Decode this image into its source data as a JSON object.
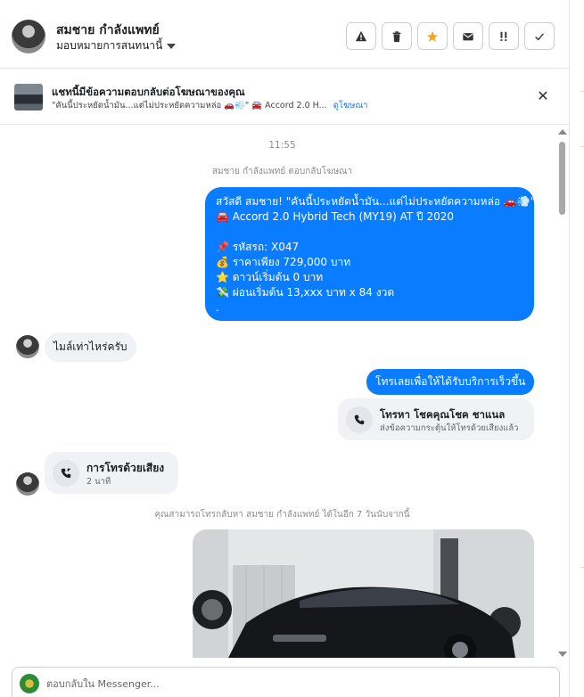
{
  "header": {
    "contact_name": "สมชาย กำลังแพทย์",
    "assign_label": "มอบหมายการสนทนานี้",
    "actions": [
      {
        "name": "report-button",
        "icon": "warning-icon",
        "glyph": "⚠"
      },
      {
        "name": "delete-button",
        "icon": "trash-icon",
        "glyph": "🗑"
      },
      {
        "name": "star-button",
        "icon": "star-icon",
        "glyph": "★"
      },
      {
        "name": "email-button",
        "icon": "envelope-icon",
        "glyph": "✉"
      },
      {
        "name": "mark-urgent-button",
        "icon": "double-exclamation-icon",
        "glyph": "!!"
      },
      {
        "name": "done-button",
        "icon": "checkmark-icon",
        "glyph": "✓"
      }
    ]
  },
  "ad_banner": {
    "title": "แชทนี้มีข้อความตอบกลับต่อโฆษณาของคุณ",
    "subtitle": "\"คันนี้ประหยัดน้ำมัน...แต่ไม่ประหยัดความหล่อ 🚗💨\" 🚘 Accord 2.0 H...",
    "link_label": "ดูโฆษณา",
    "close_glyph": "✕"
  },
  "thread": {
    "timestamp": "11:55",
    "reply_note": "สมชาย กำลังแพทย์ ตอบกลับโฆษณา",
    "ad_message_lines": [
      "สวัสดี สมชาย! \"คันนี้ประหยัดน้ำมัน...แต่ไม่ประหยัดความหล่อ 🚗💨\"",
      "🚘 Accord 2.0 Hybrid Tech (MY19) AT ปี 2020",
      "",
      "📌 รหัสรถ: X047",
      "💰 ราคาเพียง 729,000 บาท",
      "⭐ ดาวน์เริ่มต้น 0 บาท",
      "💸 ผ่อนเริ่มต้น 13,xxx บาท x 84 งวด",
      "."
    ],
    "incoming_question": "ไมล์เท่าไหร่ครับ",
    "outgoing_cta": "โทรเลยเพื่อให้ได้รับบริการเร็วขึ้น",
    "call_prompt": {
      "title": "โทรหา โชคคุณโชค ชาแนล",
      "subtitle": "ส่งข้อความกระตุ้นให้โทรด้วยเสียงแล้ว"
    },
    "voice_call": {
      "title": "การโทรด้วยเสียง",
      "duration": "2 นาที"
    },
    "callback_note": "คุณสามารถโทรกลับหา สมชาย กำลังแพทย์ ได้ในอีก 7 วันนับจากนี้"
  },
  "composer": {
    "placeholder": "ตอบกลับใน Messenger..."
  },
  "colors": {
    "outgoing_bubble": "#0a7cff",
    "incoming_bubble": "#f0f2f5",
    "link": "#1b74e4",
    "star": "#f5a623"
  }
}
